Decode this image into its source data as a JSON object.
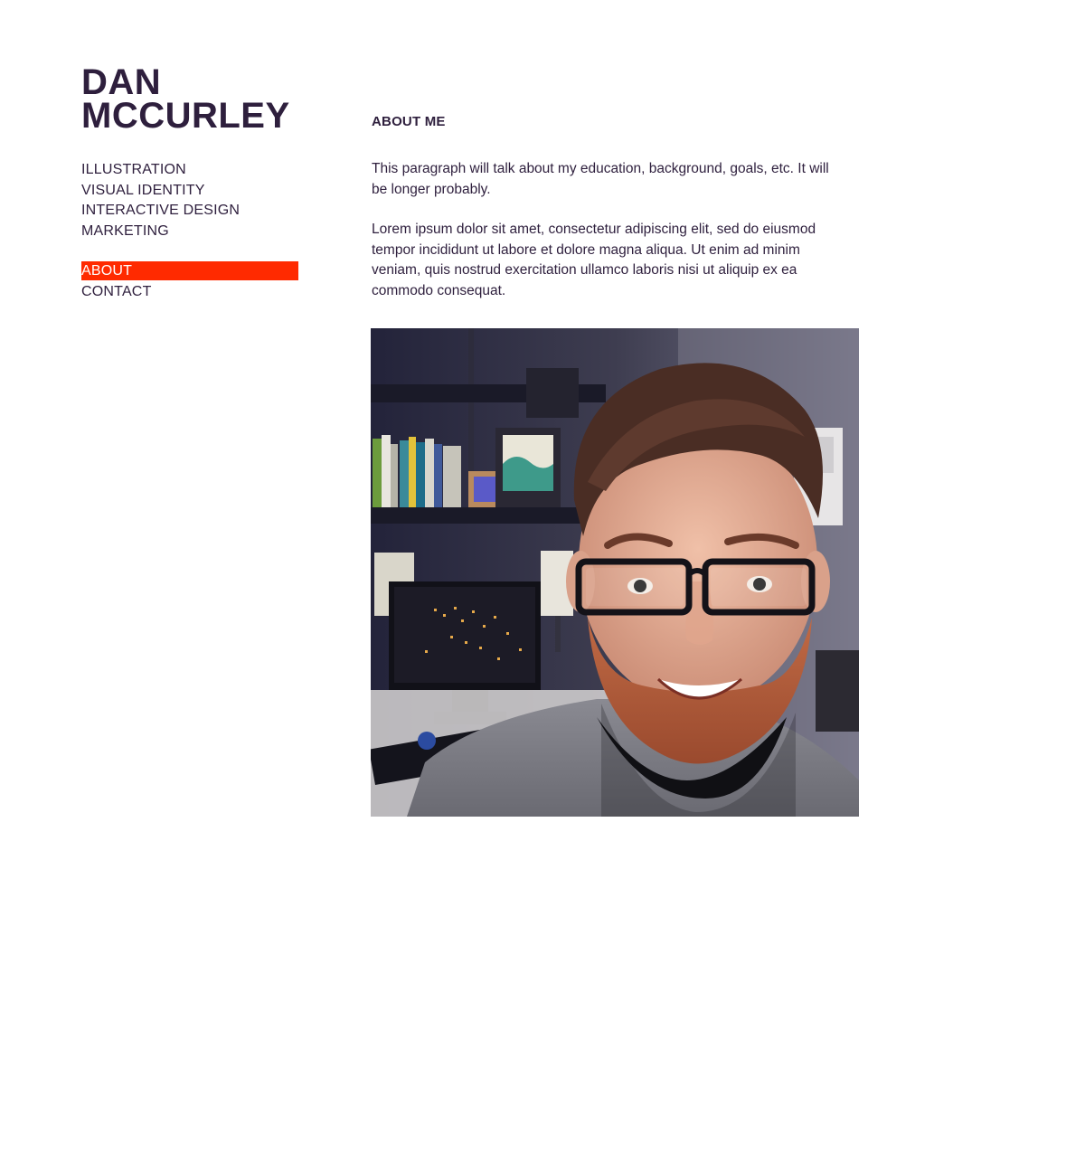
{
  "site": {
    "name_line1": "DAN",
    "name_line2": "MCCURLEY"
  },
  "nav": {
    "items": [
      {
        "label": "ILLUSTRATION"
      },
      {
        "label": "VISUAL IDENTITY"
      },
      {
        "label": "INTERACTIVE DESIGN"
      },
      {
        "label": "MARKETING"
      }
    ],
    "secondary": [
      {
        "label": "ABOUT",
        "active": true
      },
      {
        "label": "CONTACT",
        "active": false
      }
    ],
    "active_color": "#ff2a00"
  },
  "main": {
    "title": "ABOUT ME",
    "paragraph_1": "This paragraph will talk about my education, background, goals, etc. It will be longer probably.",
    "paragraph_2": "Lorem ipsum dolor sit amet, consectetur adipiscing elit, sed do eiusmod tempor incididunt ut labore et dolore magna aliqua. Ut enim ad minim veniam, quis nostrud exercitation ullamco laboris nisi ut aliquip ex ea commodo consequat."
  },
  "colors": {
    "text": "#2e1f3d",
    "accent": "#ff2a00",
    "background": "#ffffff"
  }
}
